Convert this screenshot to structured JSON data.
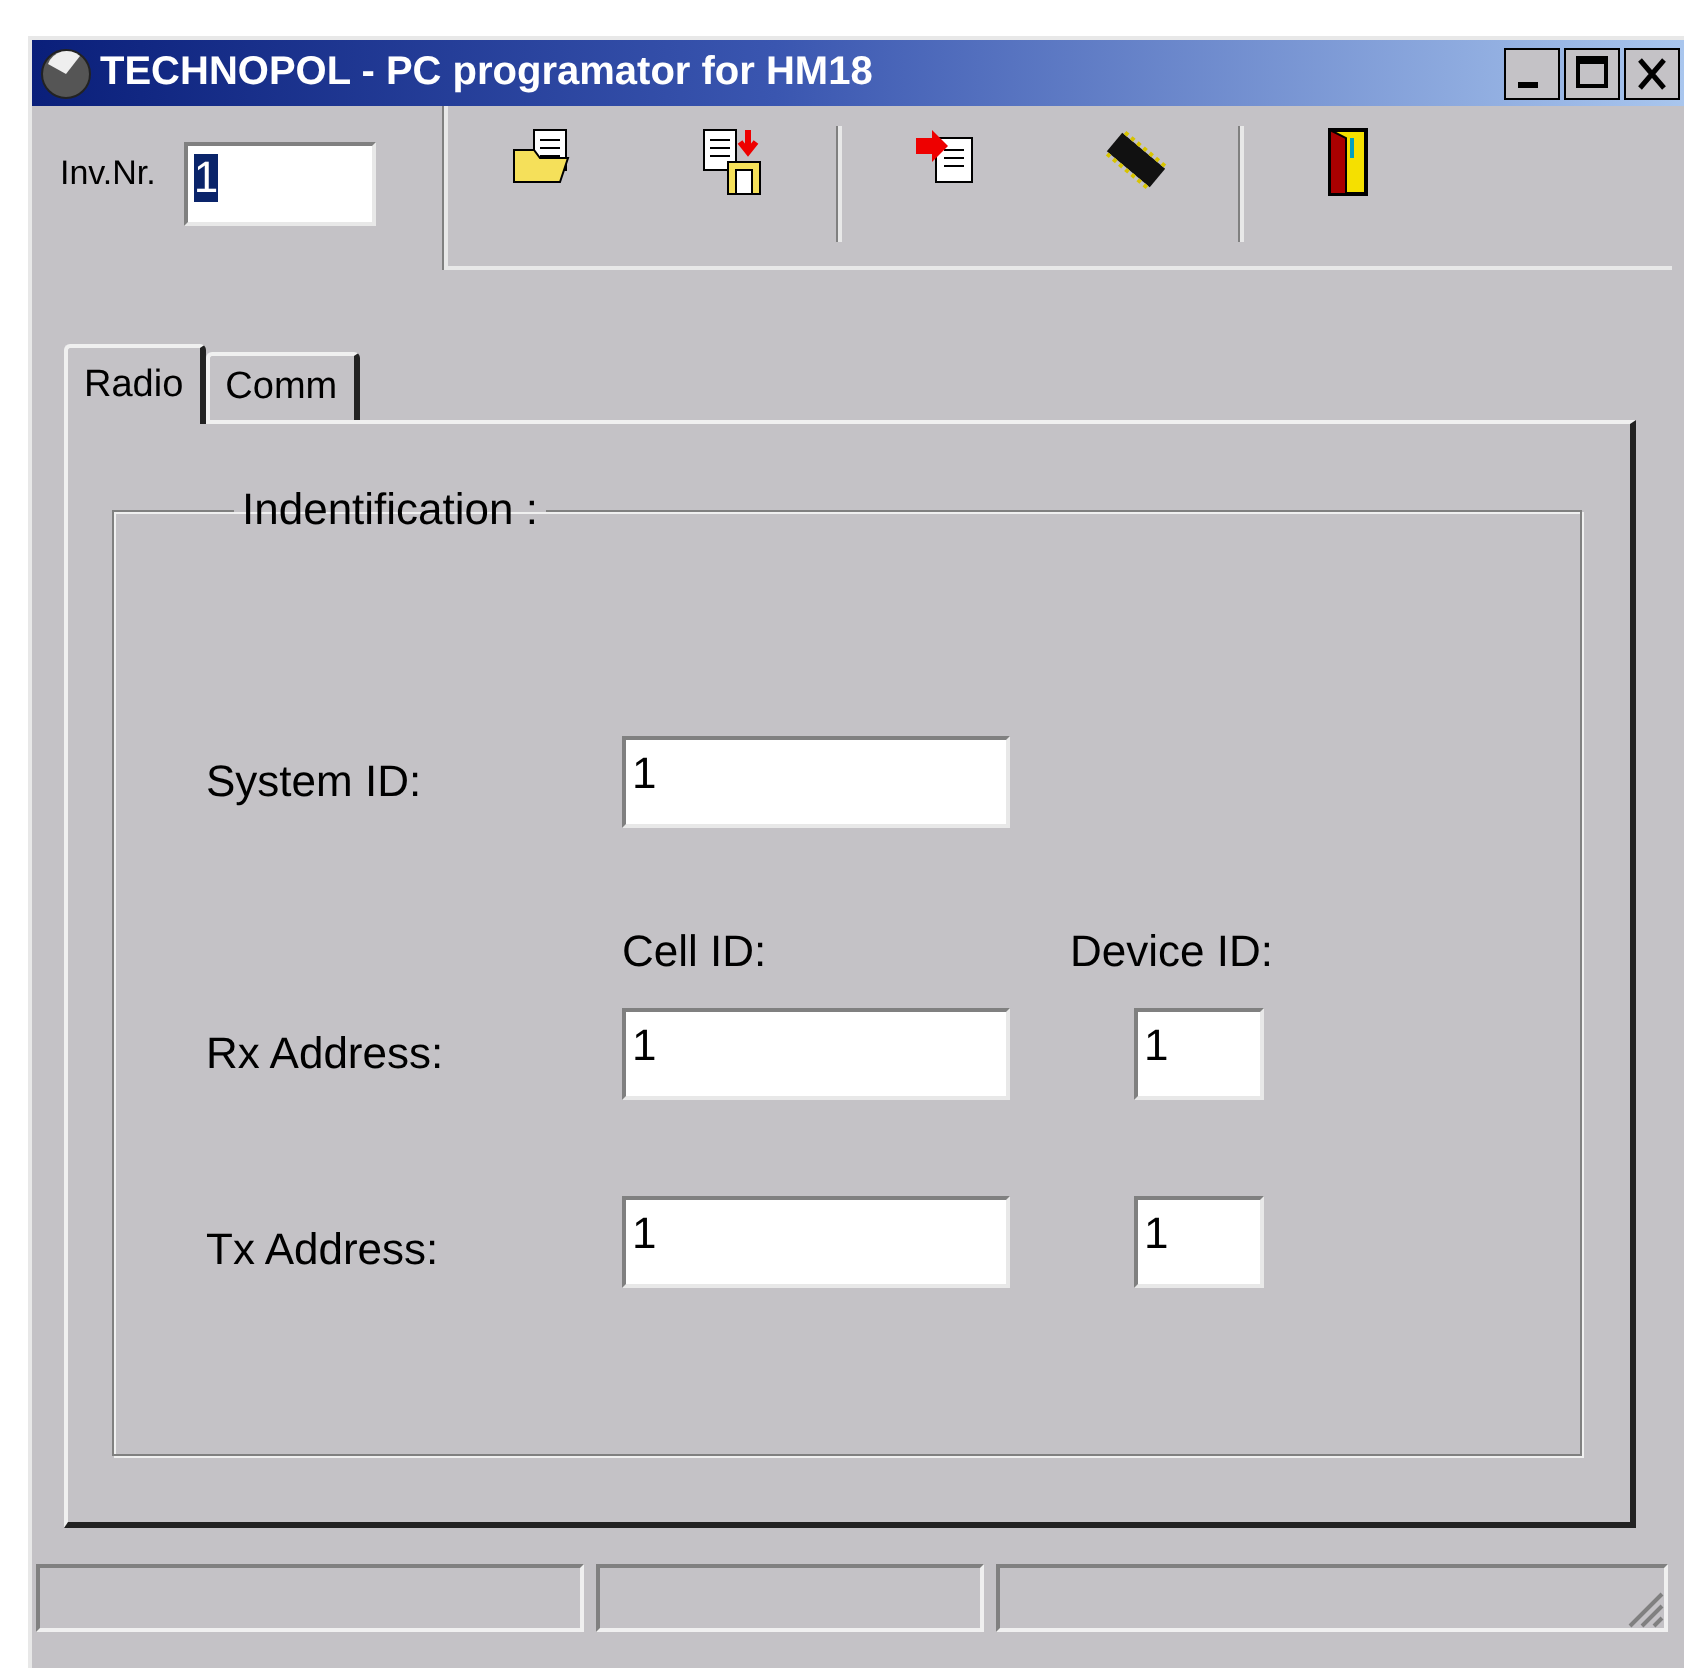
{
  "window": {
    "title": "TECHNOPOL - PC programator for HM18"
  },
  "toolbar": {
    "inv_label": "Inv.Nr.",
    "inv_value": "1",
    "inv_value_selected": true,
    "tools": [
      {
        "kind": "open"
      },
      {
        "kind": "save"
      },
      {
        "kind": "separator"
      },
      {
        "kind": "read"
      },
      {
        "kind": "chip"
      },
      {
        "kind": "separator"
      },
      {
        "kind": "exit"
      }
    ]
  },
  "tabs": [
    {
      "label": "Radio",
      "selected": true
    },
    {
      "label": "Comm",
      "selected": false
    }
  ],
  "group": {
    "title": "Indentification :",
    "system_id": {
      "label": "System ID:",
      "value": "1"
    },
    "column_headers": [
      "Cell ID:",
      "Device ID:"
    ],
    "addresses": [
      {
        "label": "Rx Address:",
        "cell_id": "1",
        "device_id": "1"
      },
      {
        "label": "Tx Address:",
        "cell_id": "1",
        "device_id": "1"
      }
    ]
  }
}
